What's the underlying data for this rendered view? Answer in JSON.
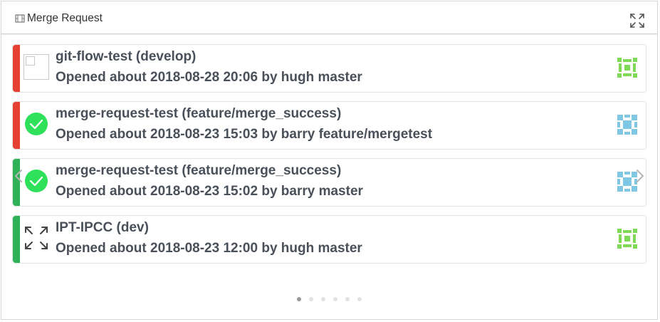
{
  "panel": {
    "title": "Merge Request"
  },
  "merge_requests": [
    {
      "title": "git-flow-test (develop)",
      "meta": "Opened about 2018-08-28 20:06 by hugh master",
      "status_color": "#e64032",
      "icon": "blank-checkbox-icon",
      "avatar_color": "#7ed957",
      "avatar": "identicon-green"
    },
    {
      "title": "merge-request-test (feature/merge_success)",
      "meta": "Opened about 2018-08-23 15:03 by barry feature/mergetest",
      "status_color": "#e64032",
      "icon": "check-circle-icon",
      "avatar_color": "#7ec8e3",
      "avatar": "identicon-blue"
    },
    {
      "title": "merge-request-test (feature/merge_success)",
      "meta": "Opened about 2018-08-23 15:02 by barry master",
      "status_color": "#2eb157",
      "icon": "check-circle-icon",
      "avatar_color": "#7ec8e3",
      "avatar": "identicon-blue"
    },
    {
      "title": "IPT-IPCC (dev)",
      "meta": "Opened about 2018-08-23 12:00 by hugh master",
      "status_color": "#2eb157",
      "icon": "expand-arrows-icon",
      "avatar_color": "#7ed957",
      "avatar": "identicon-green"
    }
  ],
  "pagination": {
    "count": 6,
    "active_index": 0
  },
  "colors": {
    "check_green": "#2ee05a",
    "border": "#e3e3e3"
  }
}
